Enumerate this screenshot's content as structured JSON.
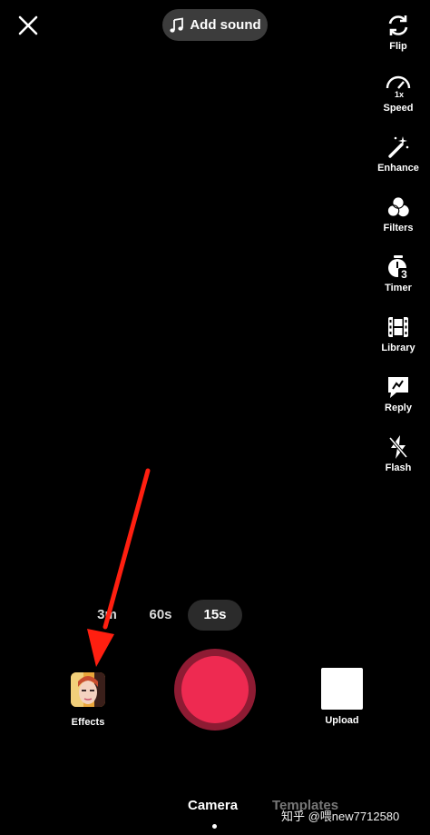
{
  "header": {
    "add_sound_label": "Add sound"
  },
  "sidebar": {
    "items": [
      {
        "label": "Flip",
        "icon": "flip-icon"
      },
      {
        "label": "Speed",
        "icon": "speed-icon",
        "badge": "1x"
      },
      {
        "label": "Enhance",
        "icon": "enhance-icon"
      },
      {
        "label": "Filters",
        "icon": "filters-icon"
      },
      {
        "label": "Timer",
        "icon": "timer-icon",
        "badge": "3"
      },
      {
        "label": "Library",
        "icon": "library-icon"
      },
      {
        "label": "Reply",
        "icon": "reply-icon"
      },
      {
        "label": "Flash",
        "icon": "flash-icon"
      }
    ]
  },
  "durations": {
    "options": [
      "3m",
      "60s",
      "15s"
    ],
    "selected": "15s"
  },
  "bottom_bar": {
    "effects_label": "Effects",
    "upload_label": "Upload"
  },
  "tabs": {
    "camera": "Camera",
    "templates": "Templates"
  },
  "watermark": "知乎 @喂new7712580",
  "colors": {
    "record": "#ee2a51",
    "record_ring": "#8e1b33",
    "arrow": "#ff1f10",
    "background": "#000000"
  }
}
